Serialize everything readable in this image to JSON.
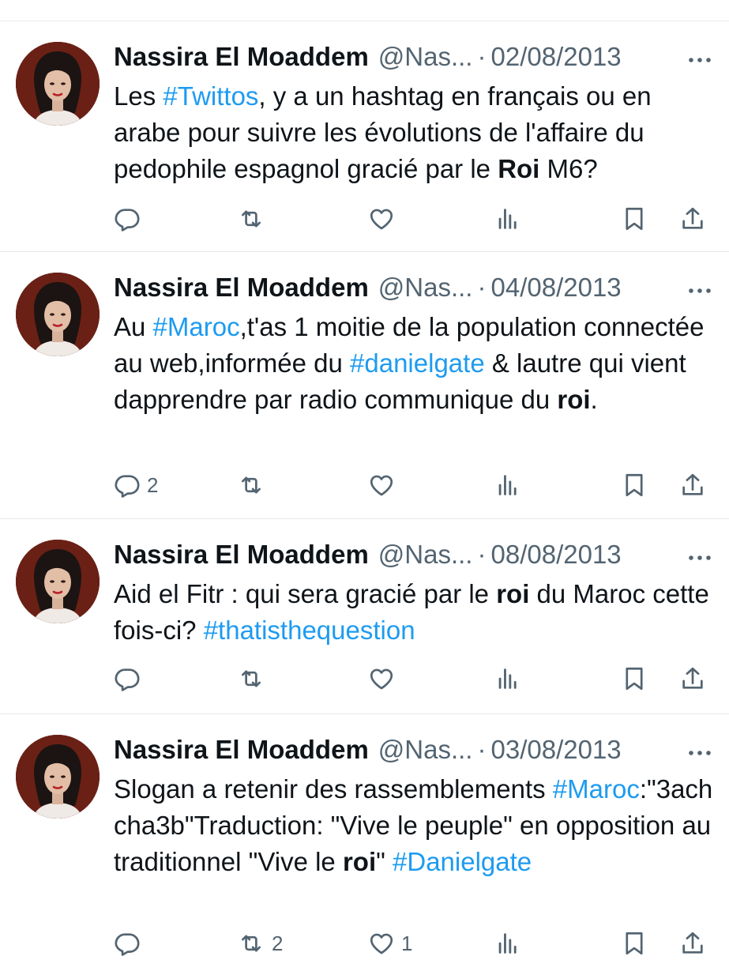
{
  "tweets": [
    {
      "author_name": "Nassira El Moaddem",
      "handle": "@Nas...",
      "separator": "·",
      "date": "02/08/2013",
      "segments": [
        {
          "t": "Les "
        },
        {
          "t": "#Twittos",
          "s": "tag"
        },
        {
          "t": ", y a un hashtag en français ou en arabe pour suivre les évolutions de l'affaire du pedophile espagnol gracié par le "
        },
        {
          "t": "Roi",
          "s": "bold"
        },
        {
          "t": " M6?"
        }
      ],
      "reply_count": "",
      "retweet_count": "",
      "like_count": ""
    },
    {
      "author_name": "Nassira El Moaddem",
      "handle": "@Nas...",
      "separator": "·",
      "date": "04/08/2013",
      "segments": [
        {
          "t": "Au "
        },
        {
          "t": "#Maroc",
          "s": "tag"
        },
        {
          "t": ",t'as 1 moitie de la population connectée au web,informée du "
        },
        {
          "t": "#danielgate",
          "s": "tag"
        },
        {
          "t": " & lautre qui vient dapprendre par radio communique du "
        },
        {
          "t": "roi",
          "s": "bold"
        },
        {
          "t": "."
        }
      ],
      "reply_count": "2",
      "retweet_count": "",
      "like_count": ""
    },
    {
      "author_name": "Nassira El Moaddem",
      "handle": "@Nas...",
      "separator": "·",
      "date": "08/08/2013",
      "segments": [
        {
          "t": "Aid el Fitr : qui sera gracié par le "
        },
        {
          "t": "roi",
          "s": "bold"
        },
        {
          "t": " du Maroc cette fois-ci? "
        },
        {
          "t": "#thatisthequestion",
          "s": "tag"
        }
      ],
      "reply_count": "",
      "retweet_count": "",
      "like_count": ""
    },
    {
      "author_name": "Nassira El Moaddem",
      "handle": "@Nas...",
      "separator": "·",
      "date": "03/08/2013",
      "segments": [
        {
          "t": "Slogan a retenir des rassemblements "
        },
        {
          "t": "#Maroc",
          "s": "tag"
        },
        {
          "t": ":\"3ach cha3b\"Traduction: \"Vive le peuple\" en opposition au traditionnel \"Vive le "
        },
        {
          "t": "roi",
          "s": "bold"
        },
        {
          "t": "\" "
        },
        {
          "t": "#Danielgate",
          "s": "tag"
        }
      ],
      "reply_count": "",
      "retweet_count": "2",
      "like_count": "1"
    }
  ],
  "icons": {
    "reply": "reply-icon",
    "retweet": "retweet-icon",
    "like": "like-icon",
    "views": "views-icon",
    "bookmark": "bookmark-icon",
    "share": "share-icon",
    "more": "more-icon"
  },
  "colors": {
    "text": "#0f1419",
    "secondary": "#536471",
    "link": "#1d9bf0",
    "divider": "#e7e9ea"
  }
}
